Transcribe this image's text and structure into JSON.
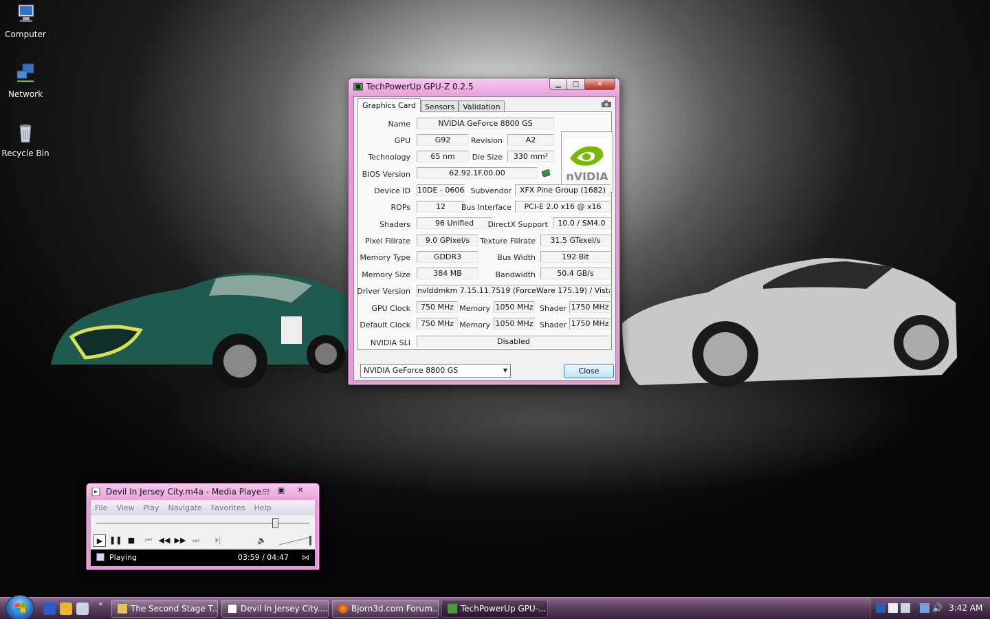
{
  "desktop": {
    "icons": [
      {
        "label": "Computer"
      },
      {
        "label": "Network"
      },
      {
        "label": "Recycle Bin"
      }
    ]
  },
  "gpuz": {
    "title": "TechPowerUp GPU-Z 0.2.5",
    "tabs": [
      "Graphics Card",
      "Sensors",
      "Validation"
    ],
    "labels": {
      "name": "Name",
      "gpu": "GPU",
      "revision": "Revision",
      "technology": "Technology",
      "die_size": "Die Size",
      "bios": "BIOS Version",
      "device_id": "Device ID",
      "subvendor": "Subvendor",
      "rops": "ROPs",
      "bus_interface": "Bus Interface",
      "shaders": "Shaders",
      "directx": "DirectX Support",
      "pixel_fillrate": "Pixel Fillrate",
      "texture_fillrate": "Texture Fillrate",
      "memory_type": "Memory Type",
      "bus_width": "Bus Width",
      "memory_size": "Memory Size",
      "bandwidth": "Bandwidth",
      "driver_version": "Driver Version",
      "gpu_clock": "GPU Clock",
      "memory": "Memory",
      "shader": "Shader",
      "default_clock": "Default Clock",
      "sli": "NVIDIA SLI"
    },
    "values": {
      "name": "NVIDIA GeForce 8800 GS",
      "gpu": "G92",
      "revision": "A2",
      "technology": "65 nm",
      "die_size": "330 mm²",
      "bios": "62.92.1F.00.00",
      "device_id": "10DE - 0606",
      "subvendor": "XFX Pine Group (1682)",
      "rops": "12",
      "bus_interface": "PCI-E 2.0 x16 @ x16",
      "shaders": "96 Unified",
      "directx": "10.0 / SM4.0",
      "pixel_fillrate": "9.0 GPixel/s",
      "texture_fillrate": "31.5 GTexel/s",
      "memory_type": "GDDR3",
      "bus_width": "192 Bit",
      "memory_size": "384 MB",
      "bandwidth": "50.4 GB/s",
      "driver_version": "nvlddmkm 7.15.11.7519 (ForceWare 175.19) / Vista",
      "gpu_clock": "750 MHz",
      "gpu_memory": "1050 MHz",
      "gpu_shader": "1750 MHz",
      "default_clock": "750 MHz",
      "default_memory": "1050 MHz",
      "default_shader": "1750 MHz",
      "sli": "Disabled"
    },
    "logo_text": "nVIDIA",
    "card_select": "NVIDIA GeForce 8800 GS",
    "close_label": "Close"
  },
  "wmp": {
    "title": "Devil In Jersey City.m4a - Media Playe...",
    "menu": [
      "File",
      "View",
      "Play",
      "Navigate",
      "Favorites",
      "Help"
    ],
    "seek_fraction": 0.838,
    "status": "Playing",
    "time": "03:59 / 04:47"
  },
  "taskbar": {
    "tasks": [
      {
        "label": "The Second Stage T..."
      },
      {
        "label": "Devil In Jersey City...."
      },
      {
        "label": "Bjorn3d.com Forum..."
      },
      {
        "label": "TechPowerUp GPU-..."
      }
    ],
    "clock": "3:42 AM"
  },
  "colors": {
    "window_frame": "#e79ad6",
    "nvidia_green": "#76b900",
    "taskbar": "#5e3f63"
  }
}
